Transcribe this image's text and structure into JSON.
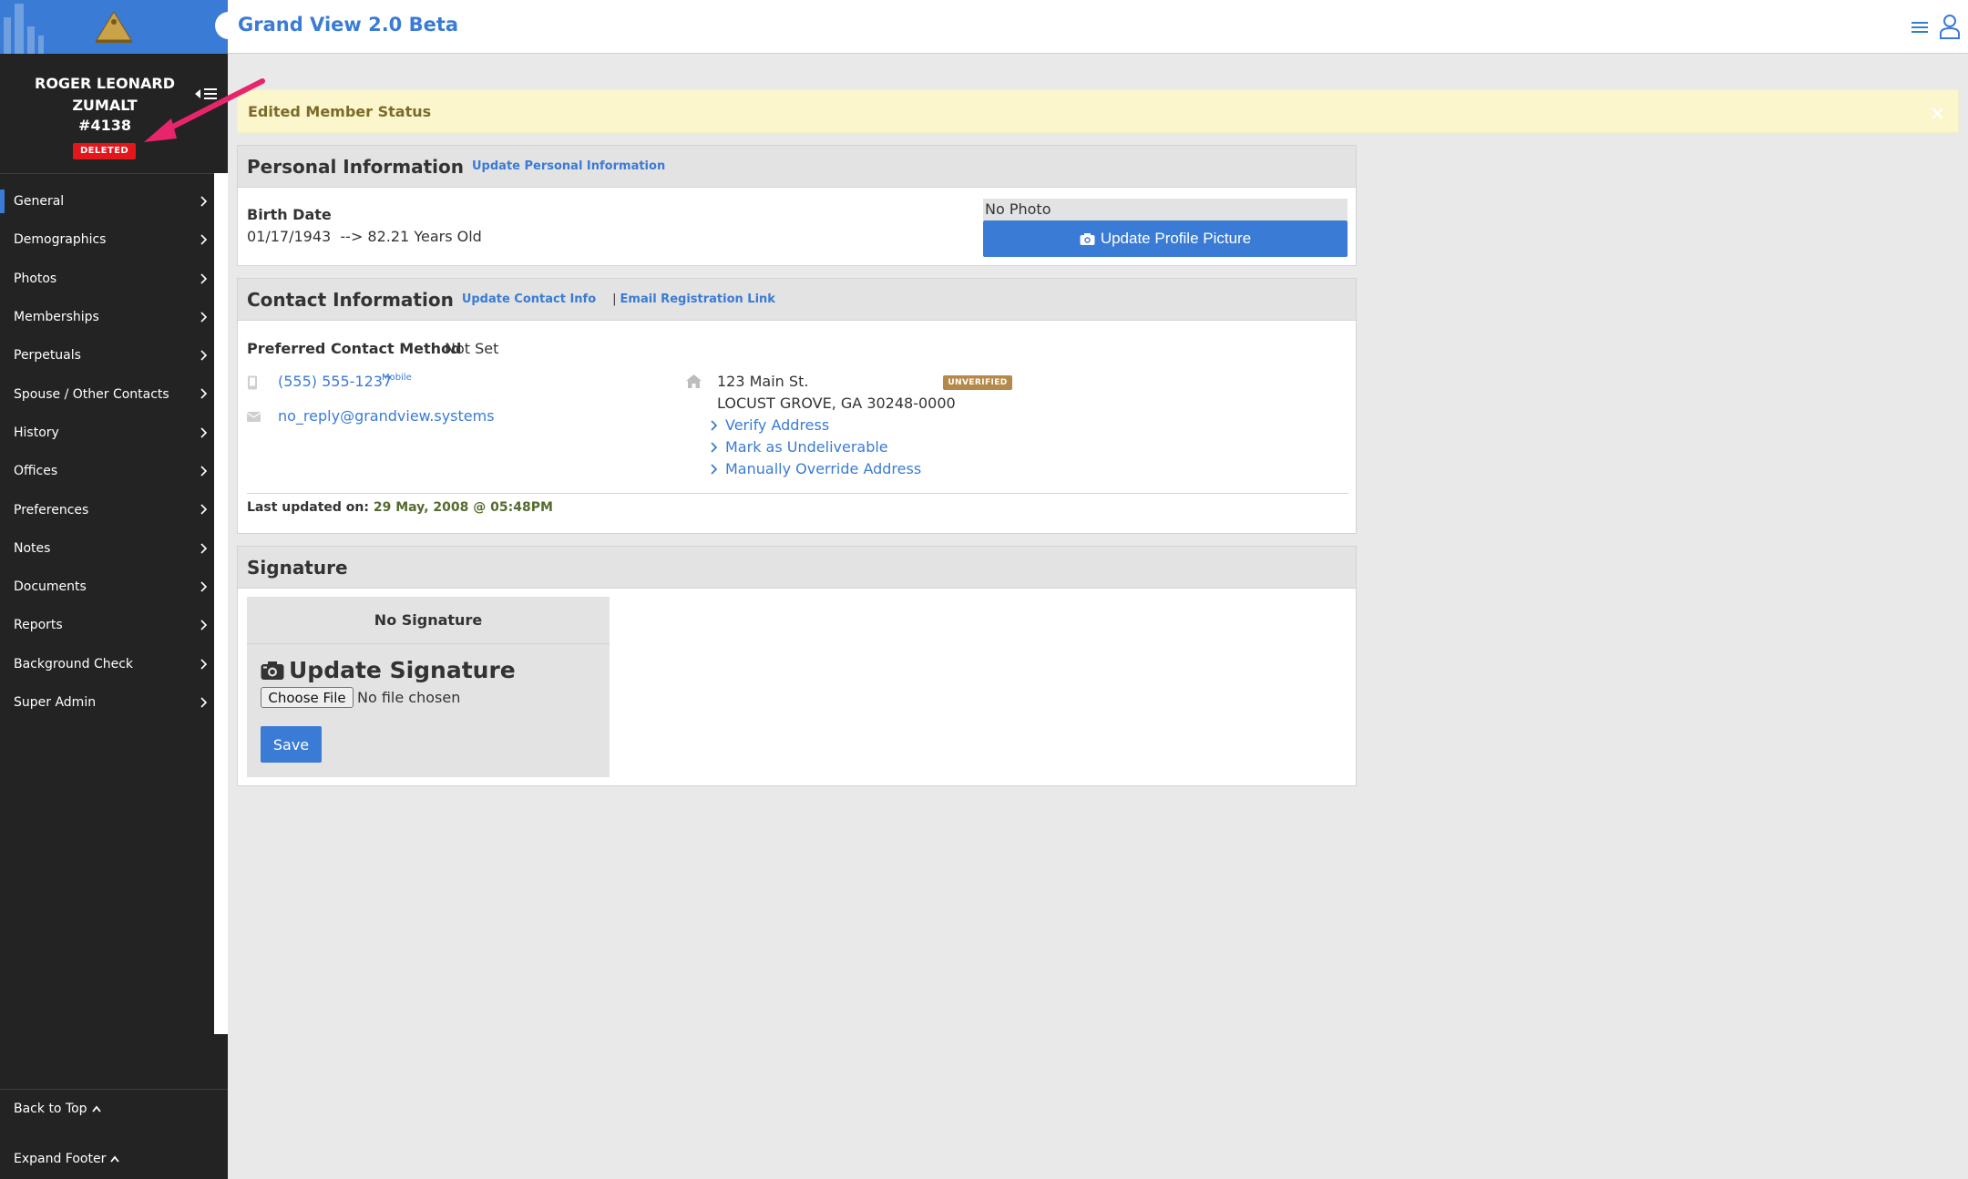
{
  "app": {
    "title": "Grand View 2.0 Beta"
  },
  "member": {
    "name": "ROGER LEONARD ZUMALT",
    "number": "#4138",
    "status_badge": "DELETED"
  },
  "sidebar": {
    "items": [
      {
        "label": "General",
        "active": true
      },
      {
        "label": "Demographics"
      },
      {
        "label": "Photos"
      },
      {
        "label": "Memberships"
      },
      {
        "label": "Perpetuals"
      },
      {
        "label": "Spouse / Other Contacts"
      },
      {
        "label": "History"
      },
      {
        "label": "Offices"
      },
      {
        "label": "Preferences"
      },
      {
        "label": "Notes"
      },
      {
        "label": "Documents"
      },
      {
        "label": "Reports"
      },
      {
        "label": "Background Check"
      },
      {
        "label": "Super Admin"
      }
    ],
    "footer": {
      "back_to_top": "Back to Top",
      "expand_footer": "Expand Footer"
    }
  },
  "alert": {
    "message": "Edited Member Status",
    "close": "×"
  },
  "personal": {
    "title": "Personal Information",
    "update_link": "Update Personal Information",
    "birth_label": "Birth Date",
    "birth_value": "01/17/1943  --> 82.21 Years Old",
    "no_photo": "No Photo",
    "update_photo_button": "Update Profile Picture"
  },
  "contact": {
    "title": "Contact Information",
    "update_link": "Update Contact Info",
    "separator": "|",
    "email_reg_link": "Email Registration Link",
    "preferred_label": "Preferred Contact Method",
    "preferred_value": "Not Set",
    "phone": "(555) 555-1237",
    "phone_type": "Mobile",
    "email": "no_reply@grandview.systems",
    "address_line1": "123 Main St.",
    "address_line2": "LOCUST GROVE, GA 30248-0000",
    "address_badge": "UNVERIFIED",
    "address_actions": [
      "Verify Address",
      "Mark as Undeliverable",
      "Manually Override Address"
    ],
    "last_updated_label": "Last updated on:",
    "last_updated_value": "29 May, 2008 @ 05:48PM"
  },
  "signature": {
    "title": "Signature",
    "none_text": "No Signature",
    "update_heading": "Update Signature",
    "choose_file": "Choose File",
    "file_status": "No file chosen",
    "save": "Save"
  },
  "colors": {
    "accent": "#3a7bd5",
    "sidebar_bg": "#232323",
    "alert_bg": "#fbf6cc",
    "deleted": "#e3161c",
    "unverified": "#b5894a",
    "annotation": "#e8246b"
  }
}
